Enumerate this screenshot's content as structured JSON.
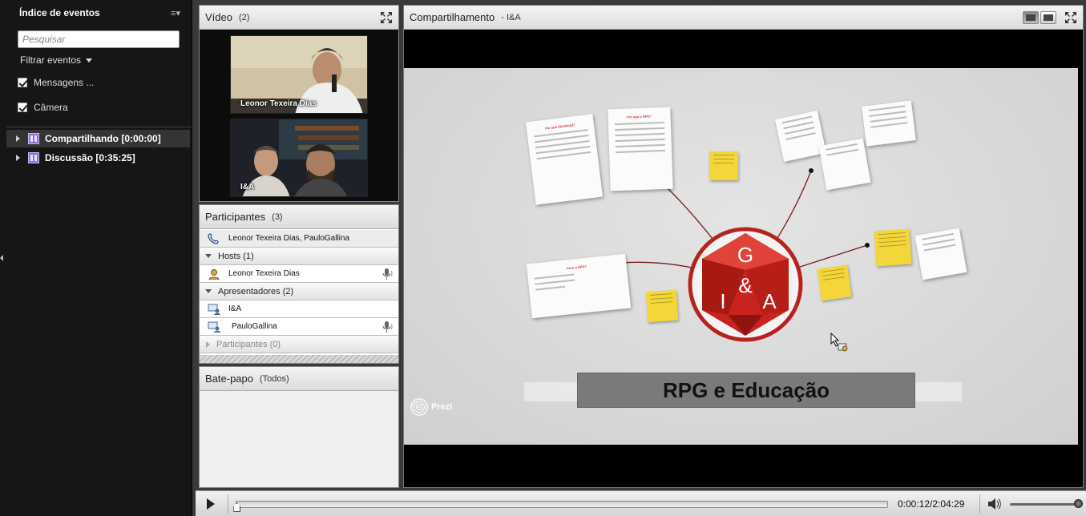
{
  "event_index": {
    "title": "Índice de eventos",
    "search_placeholder": "Pesquisar",
    "filter_label": "Filtrar eventos",
    "filters": [
      {
        "label": "Mensagens ...",
        "checked": true
      },
      {
        "label": "Câmera",
        "checked": true
      }
    ],
    "events": [
      {
        "label": "Compartilhando [0:00:00]",
        "selected": true
      },
      {
        "label": "Discussão [0:35:25]",
        "selected": false
      }
    ]
  },
  "video_pod": {
    "title": "Vídeo",
    "count": "(2)",
    "feeds": [
      {
        "name": "Leonor Texeira Dias",
        "icon": "camera-feed-speaker"
      },
      {
        "name": "I&A",
        "icon": "camera-feed-two-people"
      }
    ]
  },
  "participants_pod": {
    "title": "Participantes",
    "count": "(3)",
    "summary": "Leonor Texeira Dias, PauloGallina",
    "groups": {
      "hosts": {
        "label": "Hosts (1)",
        "members": [
          "Leonor Texeira Dias"
        ]
      },
      "presenters": {
        "label": "Apresentadores (2)",
        "members": [
          "I&A",
          "PauloGallina"
        ]
      },
      "participants": {
        "label": "Participantes (0)"
      }
    }
  },
  "chat_pod": {
    "title": "Bate-papo",
    "scope": "(Todos)"
  },
  "share_pod": {
    "title": "Compartilhamento",
    "subtitle": "- I&A",
    "slide": {
      "logo_letters": [
        "G",
        "&",
        "I",
        "A"
      ],
      "banner": "RPG e Educação",
      "watermark": "Prezi",
      "card_titles": [
        "Por que Eduhimed?",
        "Por que o RPG?",
        "Prezi o RPG?"
      ]
    }
  },
  "transport": {
    "time": "0:00:12/2:04:29",
    "progress": 0.0016,
    "volume": 1.0
  },
  "colors": {
    "logo_red": "#c8231e",
    "sticky_yellow": "#f3d73a",
    "event_purple": "#8d6fd6"
  }
}
